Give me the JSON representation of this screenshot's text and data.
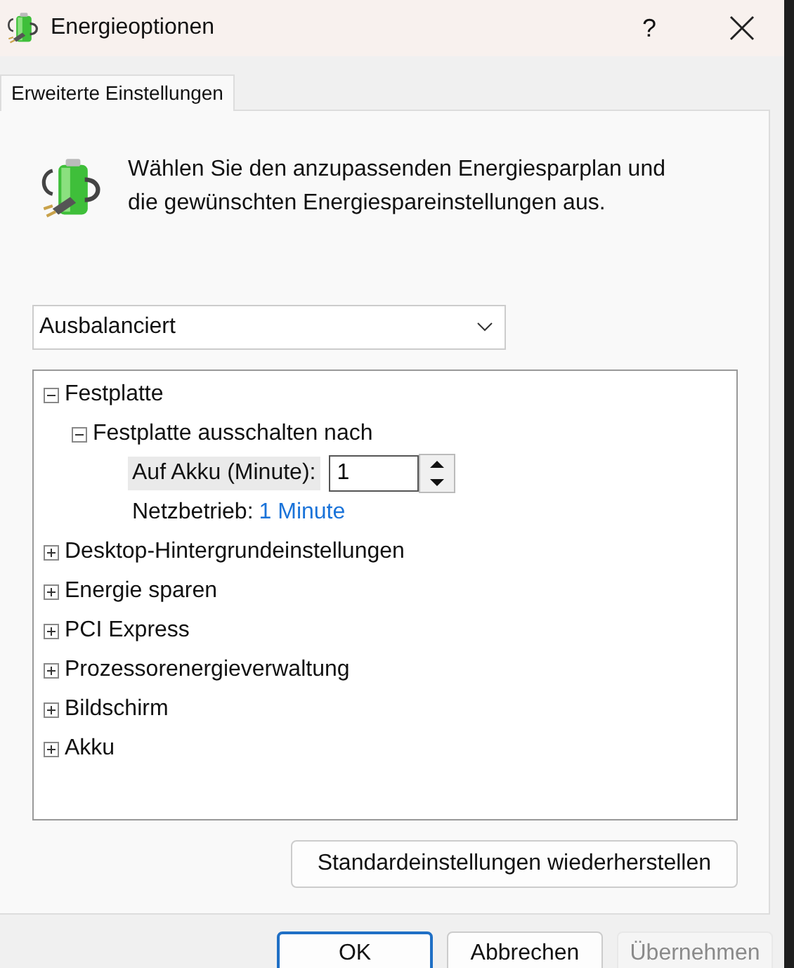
{
  "window": {
    "title": "Energieoptionen",
    "help": "?"
  },
  "tabs": [
    {
      "label": "Erweiterte Einstellungen",
      "selected": true
    }
  ],
  "intro": "Wählen Sie den anzupassenden Energiesparplan und die gewünschten Energiespareinstellungen aus.",
  "plan_dropdown": {
    "value": "Ausbalanciert"
  },
  "tree": [
    {
      "kind": "group",
      "label": "Festplatte",
      "expanded": true,
      "children": [
        {
          "kind": "group",
          "label": "Festplatte ausschalten nach",
          "expanded": true,
          "children": [
            {
              "kind": "spinner",
              "label": "Auf Akku (Minute):",
              "value": "1",
              "selected": true
            },
            {
              "kind": "value",
              "label": "Netzbetrieb:",
              "value": "1 Minute",
              "selected": false
            }
          ]
        }
      ]
    },
    {
      "kind": "group",
      "label": "Desktop-Hintergrundeinstellungen",
      "expanded": false
    },
    {
      "kind": "group",
      "label": "Energie sparen",
      "expanded": false
    },
    {
      "kind": "group",
      "label": "PCI Express",
      "expanded": false
    },
    {
      "kind": "group",
      "label": "Prozessorenergieverwaltung",
      "expanded": false
    },
    {
      "kind": "group",
      "label": "Bildschirm",
      "expanded": false
    },
    {
      "kind": "group",
      "label": "Akku",
      "expanded": false
    }
  ],
  "restore_button": "Standardeinstellungen wiederherstellen",
  "buttons": [
    {
      "label": "OK",
      "default": true,
      "disabled": false
    },
    {
      "label": "Abbrechen",
      "default": false,
      "disabled": false
    },
    {
      "label": "Übernehmen",
      "default": false,
      "disabled": true
    }
  ]
}
